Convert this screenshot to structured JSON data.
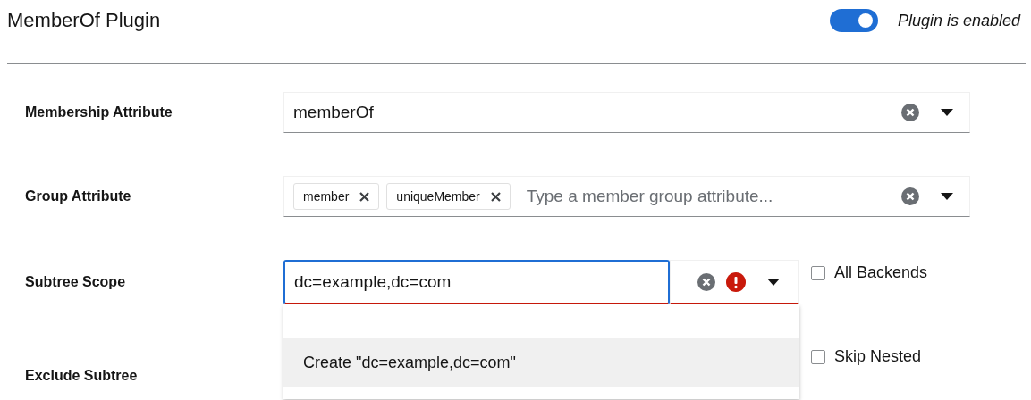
{
  "title": "MemberOf Plugin",
  "plugin_toggle": {
    "on": true,
    "label": "Plugin is enabled"
  },
  "rows": [
    {
      "kind": "select",
      "label": "Membership Attribute",
      "value": "memberOf"
    },
    {
      "kind": "chips",
      "label": "Group Attribute",
      "chips": [
        "member",
        "uniqueMember"
      ],
      "placeholder": "Type a member group attribute..."
    },
    {
      "kind": "typeahead",
      "label": "Subtree Scope",
      "value": "dc=example,dc=com",
      "invalid": true,
      "focused": true,
      "checkbox": {
        "label": "All Backends",
        "checked": false
      },
      "menu": [
        {
          "label": "Create \"dc=example,dc=com\"",
          "selected": true
        }
      ]
    },
    {
      "kind": "covered",
      "label": "Exclude Subtree",
      "checkbox": {
        "label": "Skip Nested",
        "checked": false
      }
    }
  ]
}
